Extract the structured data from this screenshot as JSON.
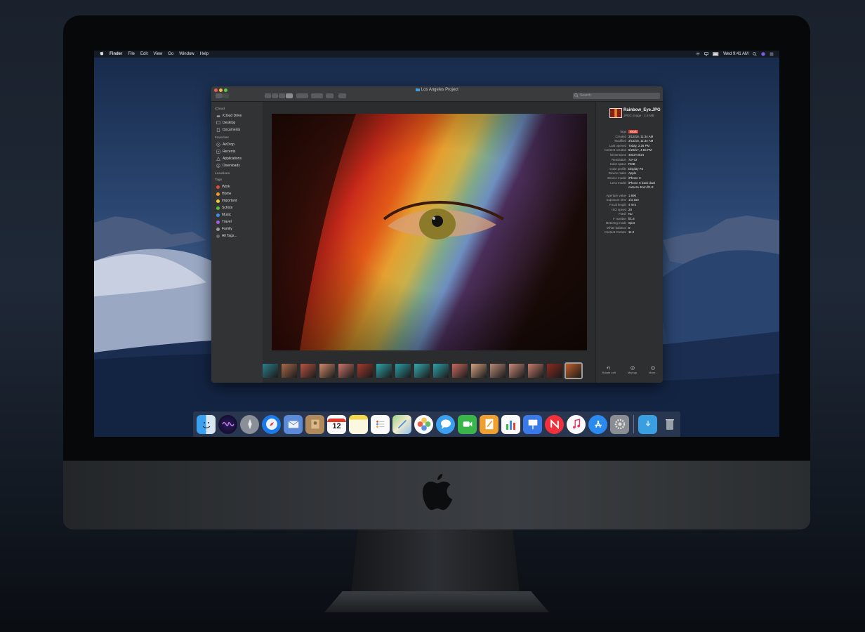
{
  "menubar": {
    "apple": "",
    "items": [
      "Finder",
      "File",
      "Edit",
      "View",
      "Go",
      "Window",
      "Help"
    ],
    "clock": "Wed 9:41 AM"
  },
  "window": {
    "title": "Los Angeles Project",
    "search_placeholder": "Search"
  },
  "sidebar": {
    "sections": [
      {
        "header": "iCloud",
        "items": [
          {
            "label": "iCloud Drive",
            "icon": "cloud-icon"
          },
          {
            "label": "Desktop",
            "icon": "desktop-icon"
          },
          {
            "label": "Documents",
            "icon": "document-icon"
          }
        ]
      },
      {
        "header": "Favorites",
        "items": [
          {
            "label": "AirDrop",
            "icon": "airdrop-icon"
          },
          {
            "label": "Recents",
            "icon": "clock-icon"
          },
          {
            "label": "Applications",
            "icon": "applications-icon"
          },
          {
            "label": "Downloads",
            "icon": "download-icon"
          }
        ]
      },
      {
        "header": "Locations",
        "items": []
      },
      {
        "header": "Tags",
        "items": [
          {
            "label": "Work",
            "color": "#e5483e"
          },
          {
            "label": "Home",
            "color": "#f39a2b"
          },
          {
            "label": "Important",
            "color": "#f2cf30"
          },
          {
            "label": "School",
            "color": "#53c23b"
          },
          {
            "label": "Music",
            "color": "#3b8ff0"
          },
          {
            "label": "Travel",
            "color": "#a55ee6"
          },
          {
            "label": "Family",
            "color": "#9a9a9a"
          },
          {
            "label": "All Tags...",
            "color": "#6a6a6a"
          }
        ]
      }
    ]
  },
  "inspector": {
    "file_name": "Rainbow_Eye.JPG",
    "file_sub": "JPEG image - 2.6 MB",
    "meta": [
      {
        "k": "Tags",
        "v": "Work",
        "tag": true
      },
      {
        "k": "Created",
        "v": "3/12/18, 11:34 AM"
      },
      {
        "k": "Modified",
        "v": "3/12/18, 11:34 AM"
      },
      {
        "k": "Last opened",
        "v": "Today, 2:26 PM"
      },
      {
        "k": "Content created",
        "v": "6/23/17, 4:55 PM"
      },
      {
        "k": "Dimensions",
        "v": "4032×3024"
      },
      {
        "k": "Resolution",
        "v": "72×72"
      },
      {
        "k": "Color space",
        "v": "RGB"
      },
      {
        "k": "Color profile",
        "v": "Display P3"
      },
      {
        "k": "Device make",
        "v": "Apple"
      },
      {
        "k": "Device model",
        "v": "iPhone X"
      },
      {
        "k": "Lens model",
        "v": "iPhone X back dual"
      },
      {
        "k": "",
        "v": "camera 4mm f/1.8"
      },
      {
        "gap": true
      },
      {
        "k": "Aperture value",
        "v": "1.696"
      },
      {
        "k": "Exposure time",
        "v": "1/3,160"
      },
      {
        "k": "Focal length",
        "v": "4 mm"
      },
      {
        "k": "ISO speed",
        "v": "20"
      },
      {
        "k": "Flash",
        "v": "No"
      },
      {
        "k": "F number",
        "v": "f/1.8"
      },
      {
        "k": "Metering mode",
        "v": "Spot"
      },
      {
        "k": "White balance",
        "v": "0"
      },
      {
        "k": "Content Creator",
        "v": "11.0"
      }
    ],
    "actions": [
      {
        "label": "Rotate Left",
        "icon": "rotate-left-icon"
      },
      {
        "label": "Markup",
        "icon": "markup-icon"
      },
      {
        "label": "More...",
        "icon": "more-icon"
      }
    ]
  },
  "filmstrip": {
    "colors": [
      "#2d7f8a",
      "#aa6a4a",
      "#b85542",
      "#d08a6a",
      "#c8766a",
      "#a23a2e",
      "#2fa2a8",
      "#2b9ea6",
      "#35a8ae",
      "#2fa0a8",
      "#c86a60",
      "#d2a080",
      "#b88a78",
      "#c98a7a",
      "#c47c6c",
      "#8a2a20",
      "#c0602a"
    ]
  },
  "calendar": {
    "day": "12"
  },
  "dock": {
    "icons": [
      "finder-icon",
      "siri-icon",
      "launchpad-icon",
      "safari-icon",
      "mail-icon",
      "contacts-icon",
      "calendar-icon",
      "notes-icon",
      "reminders-icon",
      "maps-icon",
      "photos-icon",
      "messages-icon",
      "facetime-icon",
      "pages-icon",
      "numbers-icon",
      "keynote-icon",
      "news-icon",
      "music-icon",
      "app-store-icon",
      "system-preferences-icon",
      "downloads-folder-icon",
      "trash-icon"
    ]
  }
}
